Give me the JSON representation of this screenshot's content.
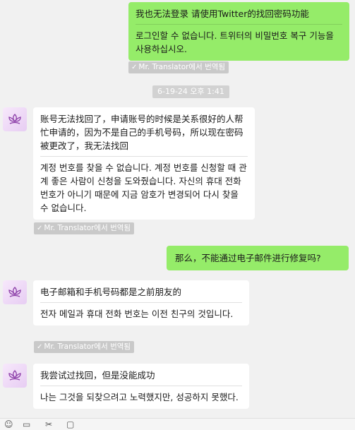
{
  "translator_tag": "Mr. Translator에서 번역됨",
  "timestamp": "6-19-24 오후 1:41",
  "messages": [
    {
      "sender": "me",
      "original": "我也无法登录  请使用Twitter的找回密码功能",
      "translation": "로그인할 수 없습니다. 트위터의 비밀번호 복구 기능을 사용하십시오."
    },
    {
      "sender": "other",
      "original": "账号无法找回了，申请账号的时候是关系很好的人帮忙申请的，因为不是自己的手机号码，所以现在密码被更改了，我无法找回",
      "translation": "계정 번호를 찾을 수 없습니다. 계정 번호를 신청할 때 관계 좋은 사람이 신청을 도와줬습니다. 자신의 휴대 전화 번호가 아니기 때문에 지금 암호가 변경되어 다시 찾을 수 없습니다."
    },
    {
      "sender": "me",
      "original": "那么，不能通过电子邮件进行修复吗?"
    },
    {
      "sender": "other",
      "original": "电子邮箱和手机号码都是之前朋友的",
      "translation": "전자 메일과 휴대 전화 번호는 이전 친구의 것입니다."
    },
    {
      "sender": "other",
      "original": "我尝试过找回，但是没能成功",
      "translation": "나는 그것을 되찾으려고 노력했지만, 성공하지 못했다."
    }
  ],
  "icons": {
    "avatar": "lotus-icon",
    "check": "check-icon",
    "toolbar": [
      "emoji-icon",
      "folder-icon",
      "scissors-icon",
      "history-icon"
    ]
  },
  "colors": {
    "my_bubble": "#95ec69",
    "other_bubble": "#ffffff",
    "background": "#f1f1f1",
    "avatar_lotus": "#8c3fa8"
  }
}
